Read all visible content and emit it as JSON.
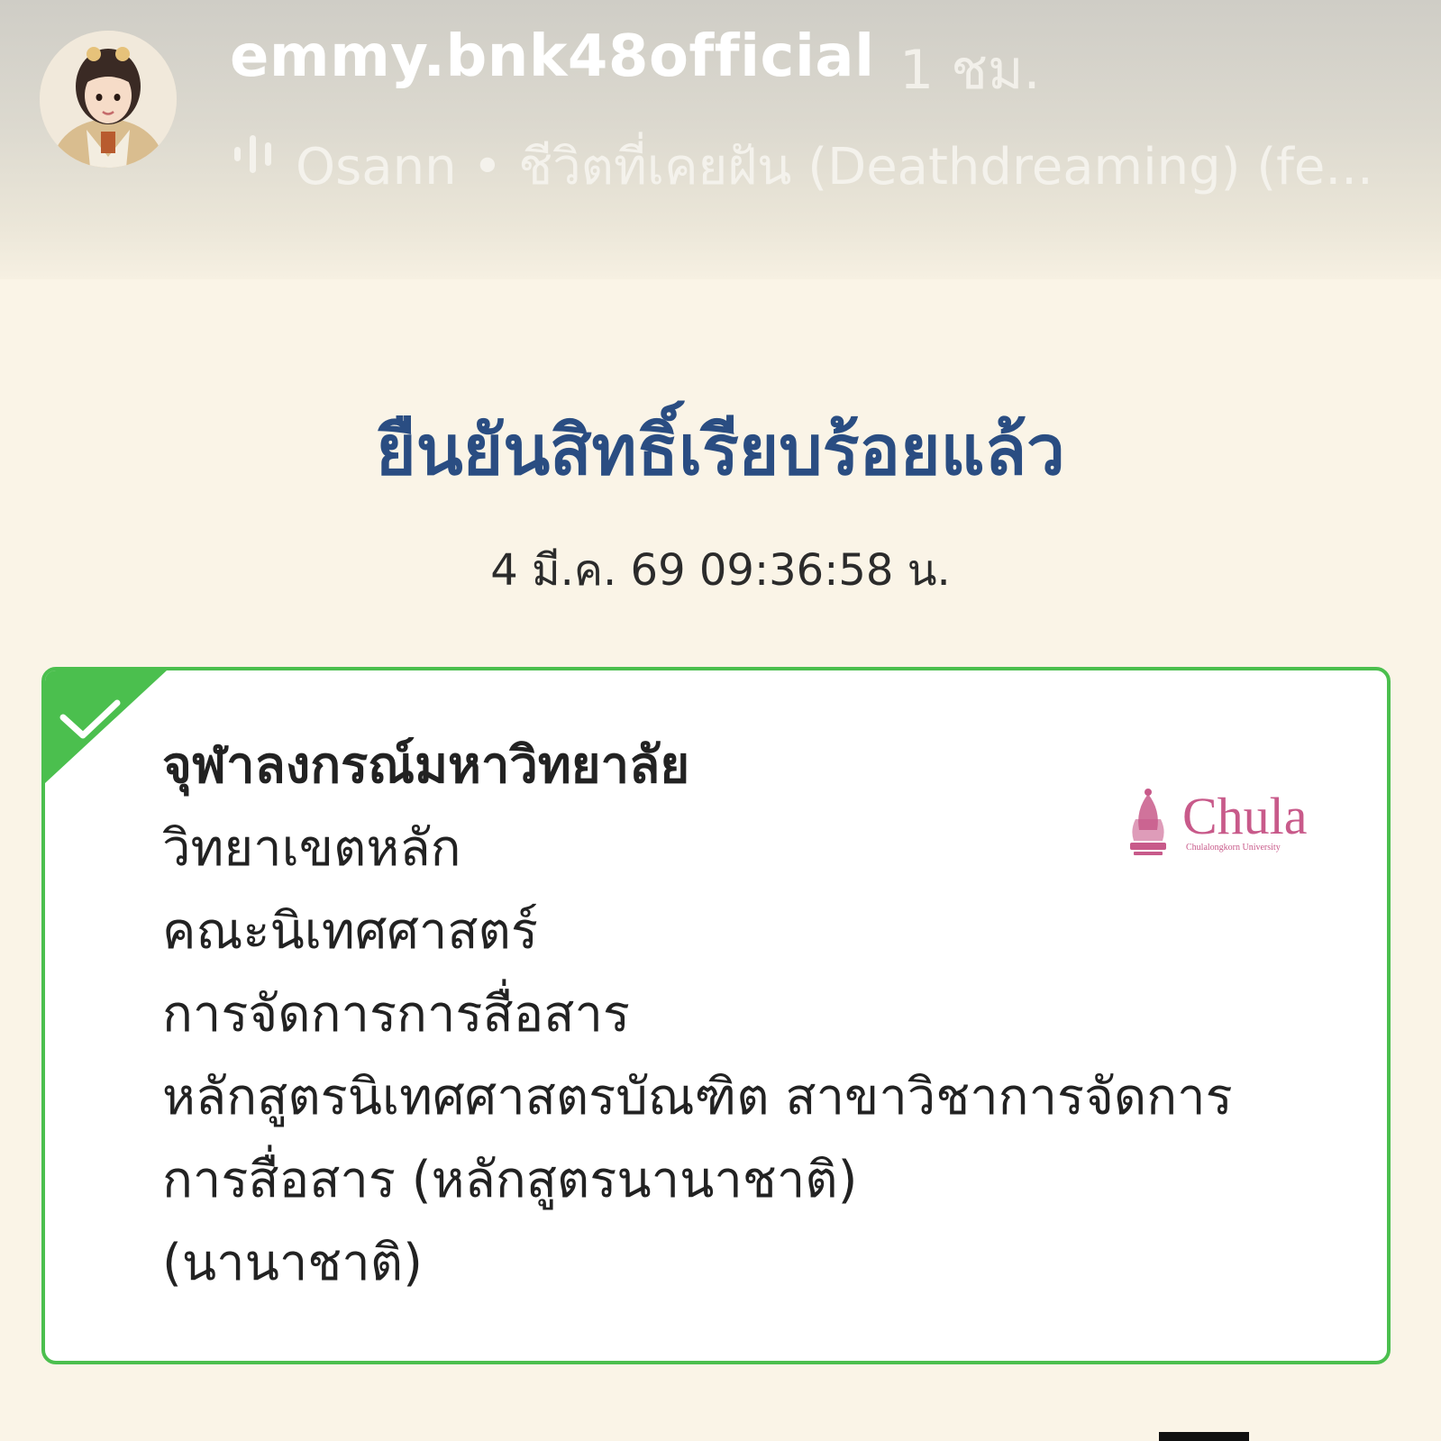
{
  "story": {
    "username": "emmy.bnk48official",
    "time_ago": "1 ชม.",
    "music_icon": "audio-wave-icon",
    "music_label": "Osann • ชีวิตที่เคยฝัน (Deathdreaming) (fe..."
  },
  "result": {
    "title": "ยืนยันสิทธิ์เรียบร้อยแล้ว",
    "datetime": "4 มี.ค. 69 09:36:58 น.",
    "status_color": "#4bbf4e",
    "title_color": "#2a4d82",
    "card_lines": [
      "จุฬาลงกรณ์มหาวิทยาลัย",
      "วิทยาเขตหลัก",
      "คณะนิเทศศาสตร์",
      "การจัดการการสื่อสาร",
      "หลักสูตรนิเทศศาสตรบัณฑิต สาขาวิชาการจัดการการสื่อสาร (หลักสูตรนานาชาติ)",
      "(นานาชาติ)"
    ],
    "logo_text": "Chula",
    "logo_subtext": "Chulalongkorn University",
    "logo_color": "#c85a8a"
  }
}
